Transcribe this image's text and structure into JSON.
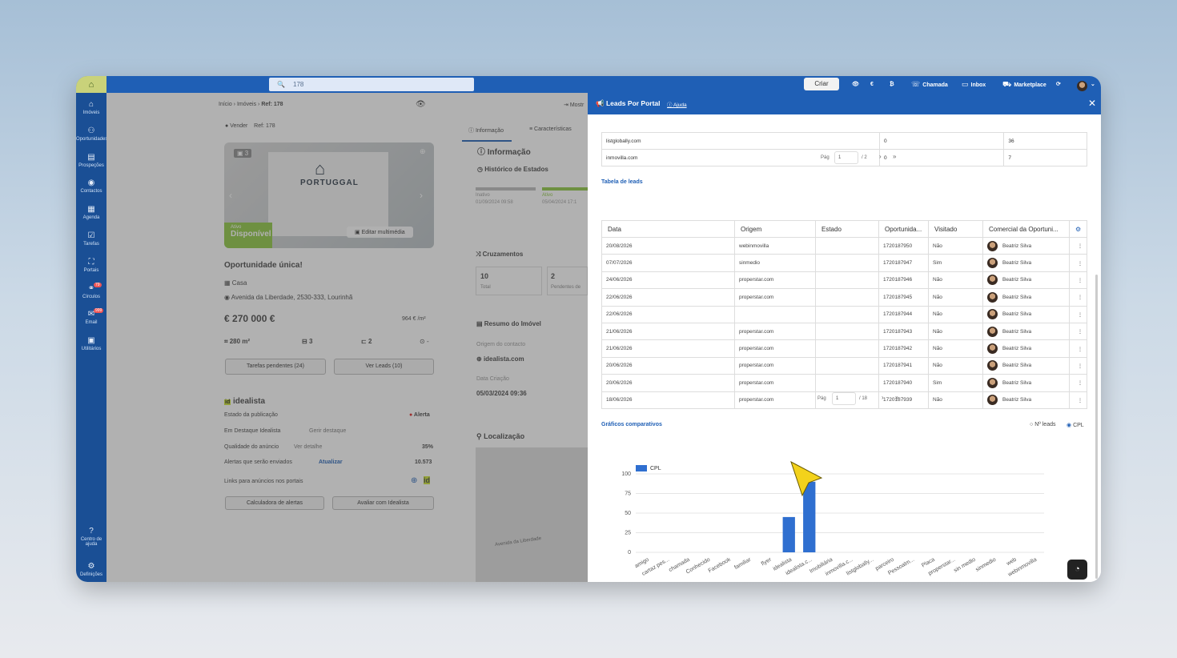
{
  "topbar": {
    "search_value": "178",
    "create_label": "Criar",
    "call_label": "Chamada",
    "inbox_label": "Inbox",
    "marketplace_label": "Marketplace"
  },
  "sidebar": {
    "items": [
      {
        "label": "Imóveis",
        "icon": "home-icon",
        "badge": ""
      },
      {
        "label": "Oportunidades",
        "icon": "people-icon",
        "badge": ""
      },
      {
        "label": "Prospeções",
        "icon": "prospect-icon",
        "badge": ""
      },
      {
        "label": "Contactos",
        "icon": "contact-icon",
        "badge": ""
      },
      {
        "label": "Agenda",
        "icon": "calendar-icon",
        "badge": ""
      },
      {
        "label": "Tarefas",
        "icon": "tasks-icon",
        "badge": ""
      },
      {
        "label": "Portais",
        "icon": "portal-icon",
        "badge": ""
      },
      {
        "label": "Círculos",
        "icon": "circles-icon",
        "badge": "79"
      },
      {
        "label": "Email",
        "icon": "mail-icon",
        "badge": "999"
      },
      {
        "label": "Utilitários",
        "icon": "tools-icon",
        "badge": ""
      }
    ],
    "help_label": "Centro de ajuda",
    "settings_label": "Definições"
  },
  "property": {
    "breadcrumb": [
      "Início",
      "Imóveis",
      "Ref: 178"
    ],
    "status_line": "Vender",
    "ref": "Ref: 178",
    "photo_count": "3",
    "logo_text": "PORTUGGAL",
    "logo_sub": "REAL ESTATE",
    "state_small": "Ativo",
    "state": "Disponível",
    "edit_media": "Editar multimédia",
    "title": "Oportunidade única!",
    "type": "Casa",
    "address": "Avenida da Liberdade, 2530-333, Lourinhã",
    "price": "270 000 €",
    "price_m2": "964 € /m²",
    "area": "280 m²",
    "bedrooms": "3",
    "bathrooms": "2",
    "energy": "-",
    "pending_tasks": "Tarefas pendentes (24)",
    "see_leads": "Ver Leads (10)",
    "idealista": {
      "brand": "idealista",
      "pub_state_label": "Estado da publicação",
      "pub_state": "Alerta",
      "highlight_label": "Em Destaque Idealista",
      "highlight_action": "Gerir destaque",
      "quality_label": "Qualidade do anúncio",
      "quality_action": "Ver detalhe",
      "quality": "35%",
      "alerts_label": "Alertas que serão enviados",
      "alerts_action": "Atualizar",
      "alerts": "10.573",
      "links_label": "Links para anúncios nos portais",
      "calc_btn": "Calculadora de alertas",
      "eval_btn": "Avaliar com Idealista"
    }
  },
  "middle": {
    "tab_info": "Informação",
    "tab_chars": "Características",
    "info_title": "Informação",
    "history_title": "Histórico de Estados",
    "hist_a": "Inativo",
    "hist_a_date": "01/09/2024 09:58",
    "hist_b": "Ativo",
    "hist_b_date": "05/04/2024 17:1",
    "crossings_title": "Cruzamentos",
    "total_val": "10",
    "total_label": "Total",
    "pending_val": "2",
    "pending_label": "Pendentes de",
    "summary_title": "Resumo do Imóvel",
    "origin_label": "Origem do contacto",
    "origin_value": "idealista.com",
    "created_label": "Data Criação",
    "created_value": "05/03/2024 09:36",
    "location_title": "Localização",
    "street_label": "Avenida da Liberdade",
    "show_label": "Mostr"
  },
  "panel": {
    "title": "Leads Por Portal",
    "help": "Ajuda",
    "portal_rows": [
      [
        "listglobally.com",
        "0",
        "36"
      ],
      [
        "inmovilla.com",
        "0",
        "7"
      ]
    ],
    "pager1": {
      "label": "Pág",
      "page": "1",
      "total": "/ 2"
    },
    "leads_title": "Tabela de leads",
    "leads_headers": [
      "Data",
      "Origem",
      "Estado",
      "Oportunida...",
      "Visitado",
      "Comercial da Oportuni..."
    ],
    "leads_rows": [
      [
        "20/08/2026",
        "webinmovilla",
        "",
        "1720187950",
        "Não",
        "Beatriz Silva"
      ],
      [
        "07/07/2026",
        "sinmedio",
        "",
        "1720187947",
        "Sim",
        "Beatriz Silva"
      ],
      [
        "24/06/2026",
        "properstar.com",
        "",
        "1720187946",
        "Não",
        "Beatriz Silva"
      ],
      [
        "22/06/2026",
        "properstar.com",
        "",
        "1720187945",
        "Não",
        "Beatriz Silva"
      ],
      [
        "22/06/2026",
        "",
        "",
        "1720187944",
        "Não",
        "Beatriz Silva"
      ],
      [
        "21/06/2026",
        "properstar.com",
        "",
        "1720187943",
        "Não",
        "Beatriz Silva"
      ],
      [
        "21/06/2026",
        "properstar.com",
        "",
        "1720187942",
        "Não",
        "Beatriz Silva"
      ],
      [
        "20/06/2026",
        "properstar.com",
        "",
        "1720187941",
        "Não",
        "Beatriz Silva"
      ],
      [
        "20/06/2026",
        "properstar.com",
        "",
        "1720187940",
        "Sim",
        "Beatriz Silva"
      ],
      [
        "18/06/2026",
        "properstar.com",
        "",
        "1720187939",
        "Não",
        "Beatriz Silva"
      ]
    ],
    "pager2": {
      "label": "Pág",
      "page": "1",
      "total": "/ 18"
    },
    "charts_title": "Gráficos comparativos",
    "radio_leads": "Nº leads",
    "radio_cpl": "CPL"
  },
  "chart_data": {
    "type": "bar",
    "legend": "top-left",
    "categories": [
      "amigo",
      "cartaz pes...",
      "chamada",
      "Conhecido",
      "Facebook",
      "familiar",
      "flyer",
      "idealista",
      "idealista.c...",
      "Imobiliária",
      "inmovilla.c...",
      "listglobally...",
      "parceiro",
      "Pessoalm...",
      "Placa",
      "properstar...",
      "sin medio",
      "sinmedio",
      "web",
      "webinmovilla"
    ],
    "series": [
      {
        "name": "CPL",
        "color": "#2f6fd0",
        "values": [
          0,
          0,
          0,
          0,
          0,
          0,
          0,
          45,
          90,
          0,
          0,
          0,
          0,
          0,
          0,
          0,
          0,
          0,
          0,
          0
        ]
      }
    ],
    "yticks": [
      "0",
      "25",
      "50",
      "75",
      "100"
    ],
    "ylim": [
      0,
      100
    ]
  }
}
